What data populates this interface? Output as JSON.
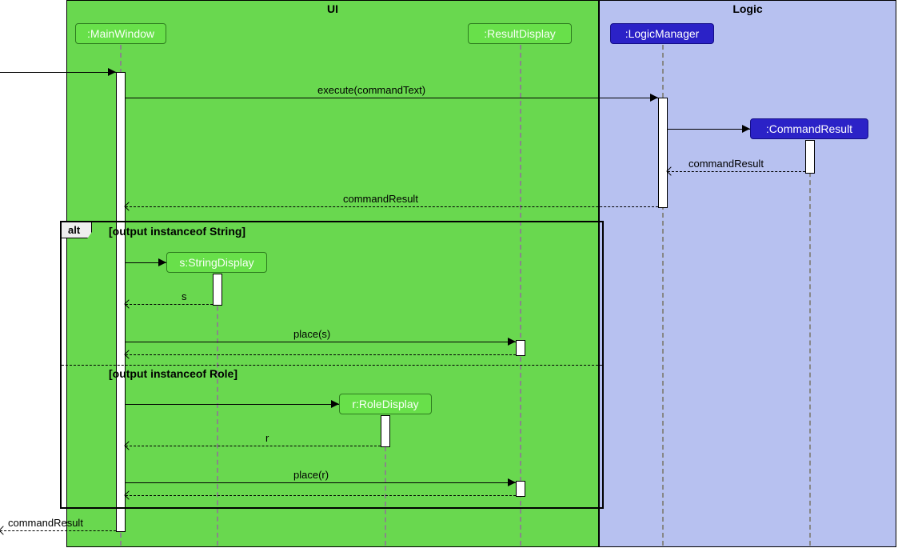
{
  "packages": {
    "ui": "UI",
    "logic": "Logic"
  },
  "participants": {
    "mainwindow": ":MainWindow",
    "resultdisplay": ":ResultDisplay",
    "logicmanager": ":LogicManager",
    "commandresult": ":CommandResult",
    "stringdisplay": "s:StringDisplay",
    "roledisplay": "r:RoleDisplay"
  },
  "messages": {
    "execute": "execute(commandText)",
    "commandResult1": "commandResult",
    "commandResult2": "commandResult",
    "s_return": "s",
    "place_s": "place(s)",
    "r_return": "r",
    "place_r": "place(r)",
    "commandResult_out": "commandResult"
  },
  "frame": {
    "alt": "alt",
    "guard1": "[output instanceof String]",
    "guard2": "[output instanceof Role]"
  }
}
